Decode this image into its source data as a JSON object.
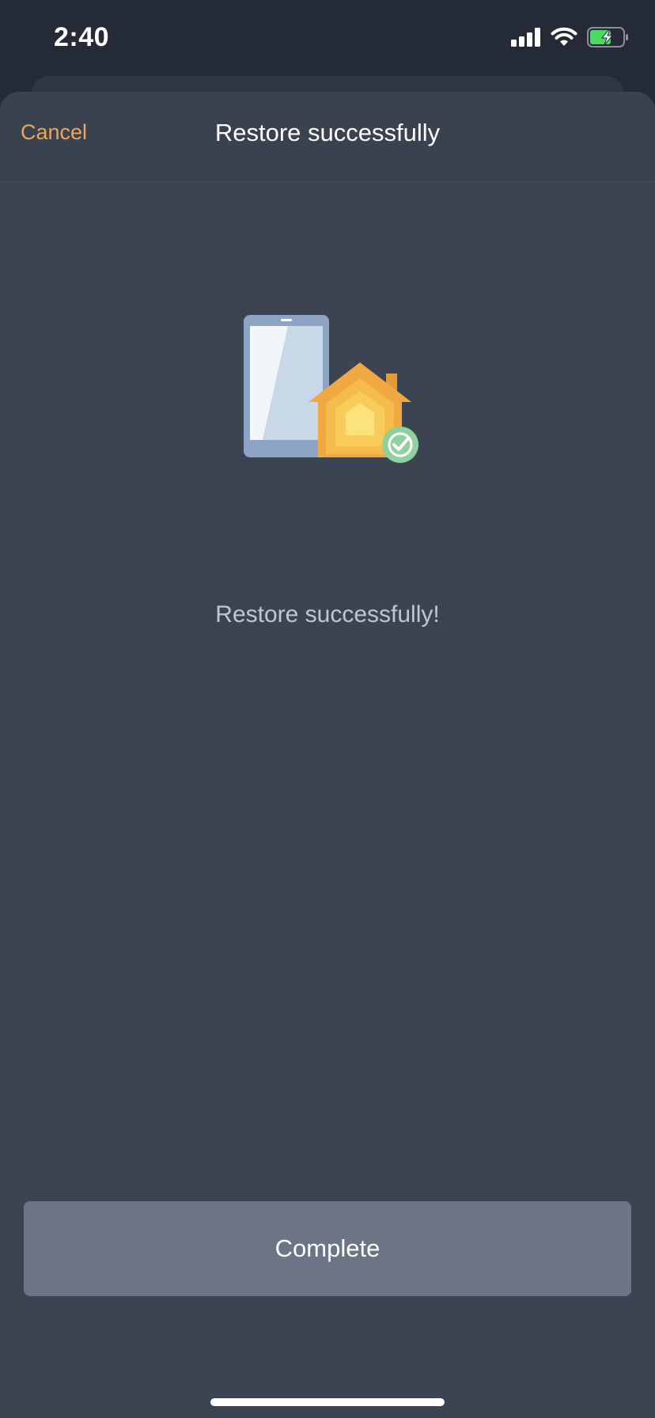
{
  "status_bar": {
    "time": "2:40",
    "icons": [
      "cellular-signal-icon",
      "wifi-icon",
      "battery-charging-icon"
    ]
  },
  "nav": {
    "cancel_label": "Cancel",
    "title": "Restore successfully"
  },
  "main": {
    "illustration": "phone-home-restore-icon",
    "message": "Restore successfully!"
  },
  "footer": {
    "complete_label": "Complete"
  },
  "colors": {
    "accent": "#eba65a",
    "background": "#3c4452",
    "button": "#6c7585",
    "success_badge": "#8fd19e"
  }
}
